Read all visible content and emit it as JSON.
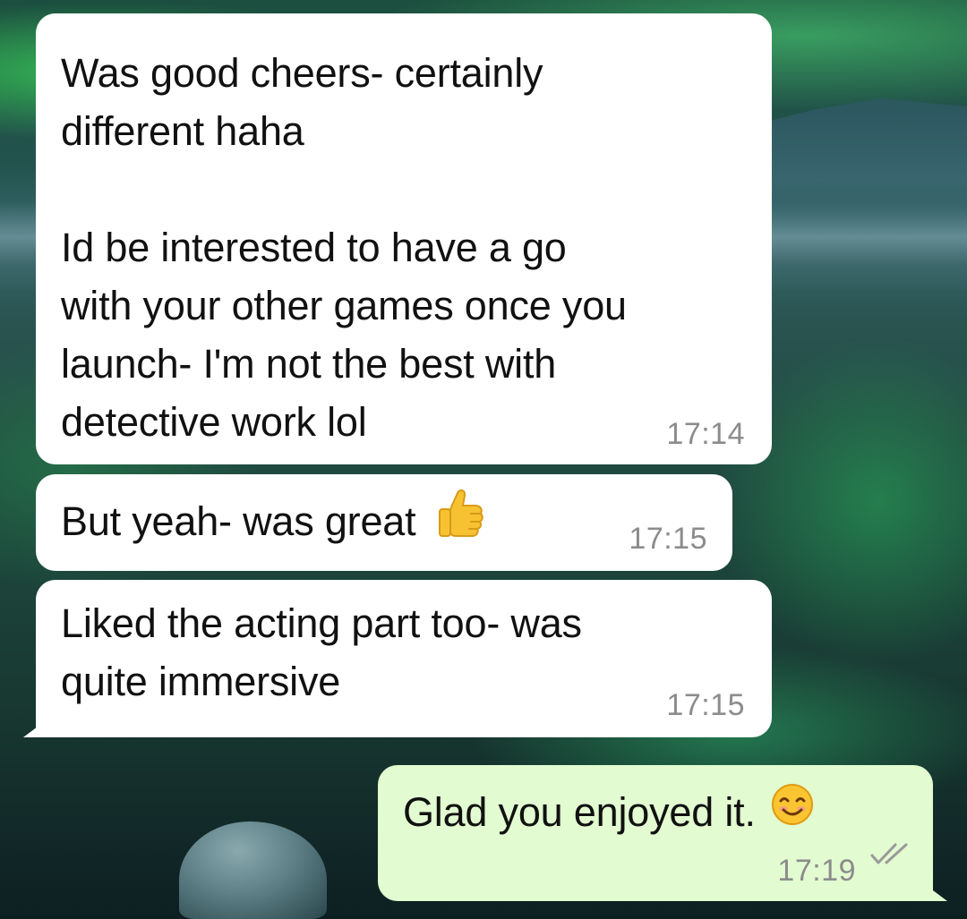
{
  "messages": [
    {
      "direction": "incoming",
      "text": "Was good cheers- certainly\ndifferent haha\n\nId be interested to have a go\nwith your other games once you\nlaunch- I'm not the best with\ndetective work lol",
      "time": "17:14"
    },
    {
      "direction": "incoming",
      "text": "But yeah- was great",
      "emoji": "thumbs-up-icon",
      "time": "17:15"
    },
    {
      "direction": "incoming",
      "text": "Liked the acting part too- was\nquite immersive",
      "time": "17:15"
    },
    {
      "direction": "outgoing",
      "text": "Glad you enjoyed it.",
      "emoji": "smiling-face-icon",
      "time": "17:19",
      "status": "read-double-check-icon"
    }
  ],
  "colors": {
    "incoming_bubble": "#ffffff",
    "outgoing_bubble": "#e2fbd0",
    "timestamp": "#8c8c8c",
    "text": "#111111"
  }
}
